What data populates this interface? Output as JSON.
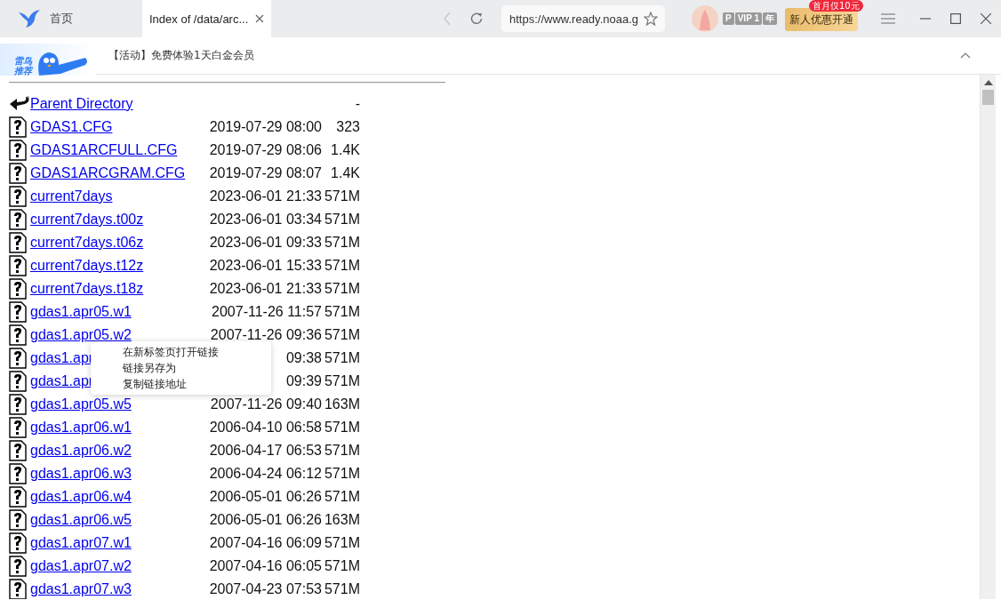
{
  "tabs": [
    {
      "label": "首页",
      "selected": false,
      "closable": false
    },
    {
      "label": "Index of /data/arc...",
      "selected": true,
      "closable": true
    }
  ],
  "toolbar": {
    "back_disabled": true,
    "address": "https://www.ready.noaa.g",
    "vip": {
      "p": "P",
      "level": "VIP 1",
      "term": "年"
    },
    "promo": {
      "label": "新人优惠开通",
      "badge": "首月仅10元"
    }
  },
  "banner": {
    "logo_lines": [
      "雷鸟",
      "推荐"
    ],
    "text": "【活动】免费体验1天白金会员"
  },
  "listing": {
    "rows": [
      {
        "kind": "parent",
        "name": "Parent Directory",
        "modified": "",
        "size": "-"
      },
      {
        "kind": "file",
        "name": "GDAS1.CFG",
        "modified": "2019-07-29 08:00",
        "size": "323"
      },
      {
        "kind": "file",
        "name": "GDAS1ARCFULL.CFG",
        "modified": "2019-07-29 08:06",
        "size": "1.4K"
      },
      {
        "kind": "file",
        "name": "GDAS1ARCGRAM.CFG",
        "modified": "2019-07-29 08:07",
        "size": "1.4K"
      },
      {
        "kind": "file",
        "name": "current7days",
        "modified": "2023-06-01 21:33",
        "size": "571M"
      },
      {
        "kind": "file",
        "name": "current7days.t00z",
        "modified": "2023-06-01 03:34",
        "size": "571M"
      },
      {
        "kind": "file",
        "name": "current7days.t06z",
        "modified": "2023-06-01 09:33",
        "size": "571M"
      },
      {
        "kind": "file",
        "name": "current7days.t12z",
        "modified": "2023-06-01 15:33",
        "size": "571M"
      },
      {
        "kind": "file",
        "name": "current7days.t18z",
        "modified": "2023-06-01 21:33",
        "size": "571M"
      },
      {
        "kind": "file",
        "name": "gdas1.apr05.w1",
        "modified": "2007-11-26 11:57",
        "size": "571M"
      },
      {
        "kind": "file",
        "name": "gdas1.apr05.w2",
        "modified": "2007-11-26 09:36",
        "size": "571M"
      },
      {
        "kind": "file",
        "name": "gdas1.apr",
        "modified": "09:38",
        "size": "571M"
      },
      {
        "kind": "file",
        "name": "gdas1.apr",
        "modified": "09:39",
        "size": "571M"
      },
      {
        "kind": "file",
        "name": "gdas1.apr05.w5",
        "modified": "2007-11-26 09:40",
        "size": "163M"
      },
      {
        "kind": "file",
        "name": "gdas1.apr06.w1",
        "modified": "2006-04-10 06:58",
        "size": "571M"
      },
      {
        "kind": "file",
        "name": "gdas1.apr06.w2",
        "modified": "2006-04-17 06:53",
        "size": "571M"
      },
      {
        "kind": "file",
        "name": "gdas1.apr06.w3",
        "modified": "2006-04-24 06:12",
        "size": "571M"
      },
      {
        "kind": "file",
        "name": "gdas1.apr06.w4",
        "modified": "2006-05-01 06:26",
        "size": "571M"
      },
      {
        "kind": "file",
        "name": "gdas1.apr06.w5",
        "modified": "2006-05-01 06:26",
        "size": "163M"
      },
      {
        "kind": "file",
        "name": "gdas1.apr07.w1",
        "modified": "2007-04-16 06:09",
        "size": "571M"
      },
      {
        "kind": "file",
        "name": "gdas1.apr07.w2",
        "modified": "2007-04-16 06:05",
        "size": "571M"
      },
      {
        "kind": "file",
        "name": "gdas1.apr07.w3",
        "modified": "2007-04-23 07:53",
        "size": "571M"
      }
    ]
  },
  "context_menu": {
    "items": [
      "在新标签页打开链接",
      "链接另存为",
      "复制链接地址"
    ]
  }
}
